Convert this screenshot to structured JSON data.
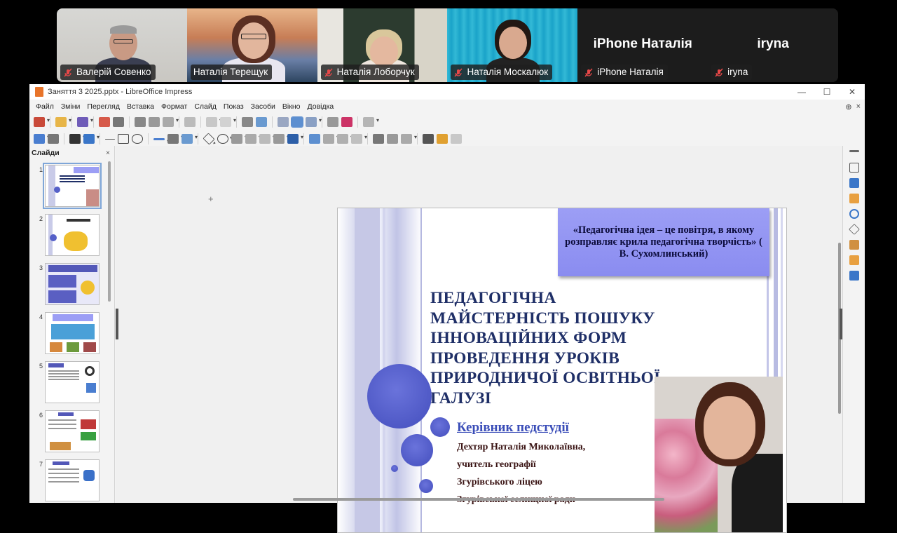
{
  "participants": [
    {
      "name": "Валерій Совенко",
      "muted": true,
      "has_video": true,
      "active": false
    },
    {
      "name": "Наталія Терещук",
      "muted": false,
      "has_video": true,
      "active": true
    },
    {
      "name": "Наталія Лоборчук",
      "muted": true,
      "has_video": true,
      "active": false
    },
    {
      "name": "Наталія Москалюк",
      "muted": true,
      "has_video": true,
      "active": false
    },
    {
      "name": "iPhone Наталія",
      "big_name": "iPhone Наталія",
      "muted": true,
      "has_video": false,
      "active": false
    },
    {
      "name": "iryna",
      "big_name": "iryna",
      "muted": true,
      "has_video": false,
      "active": false
    }
  ],
  "window": {
    "title": "Заняття 3  2025.pptx - LibreOffice Impress",
    "controls": [
      "—",
      "☐",
      "✕"
    ]
  },
  "menu": [
    {
      "label": "Файл"
    },
    {
      "label": "Зміни"
    },
    {
      "label": "Перегляд"
    },
    {
      "label": "Вставка"
    },
    {
      "label": "Формат"
    },
    {
      "label": "Слайд"
    },
    {
      "label": "Показ"
    },
    {
      "label": "Засоби"
    },
    {
      "label": "Вікно"
    },
    {
      "label": "Довідка"
    }
  ],
  "slide_pane": {
    "title": "Слайди",
    "close": "×",
    "thumbs": [
      {
        "num": "1",
        "selected": true
      },
      {
        "num": "2",
        "selected": false
      },
      {
        "num": "3",
        "selected": false
      },
      {
        "num": "4",
        "selected": false
      },
      {
        "num": "5",
        "selected": false
      },
      {
        "num": "6",
        "selected": false
      },
      {
        "num": "7",
        "selected": false
      }
    ]
  },
  "slide": {
    "quote": "«Педагогічна ідея – це повітря, в якому розправляє крила педагогічна творчість» ( В. Сухомлинський)",
    "title": "ПЕДАГОГІЧНА МАЙСТЕРНІСТЬ ПОШУКУ ІННОВАЦІЙНИХ ФОРМ ПРОВЕДЕННЯ УРОКІВ ПРИРОДНИЧОЇ ОСВІТНЬОЇ ГАЛУЗІ",
    "leader_label": "Керівник педстудії",
    "lines": [
      "Дехтяр Наталія Миколаївна,",
      "учитель  географії",
      "Згурівського ліцею",
      "Згурівської селищної ради"
    ]
  },
  "colors": {
    "active_speaker": "#2ecc71",
    "title": "#1f2f67",
    "quote_box": "#9c9ef5",
    "circles": "#5560c8",
    "leader": "#3a4db8"
  }
}
